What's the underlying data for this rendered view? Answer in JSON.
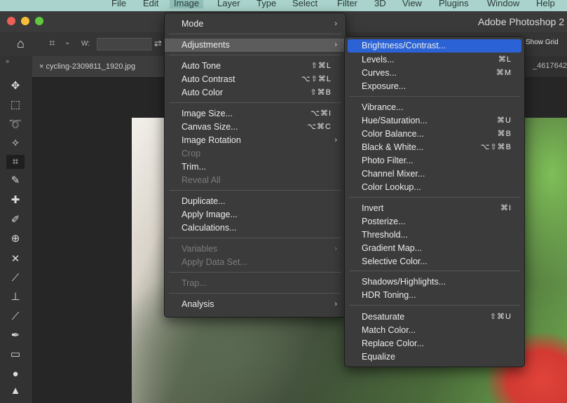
{
  "menubar": {
    "items": [
      "File",
      "Edit",
      "Image",
      "Layer",
      "Type",
      "Select",
      "Filter",
      "3D",
      "View",
      "Plugins",
      "Window",
      "Help"
    ]
  },
  "window": {
    "title": "Adobe Photoshop 2",
    "traffic_colors": [
      "#ee5f57",
      "#f6be3b",
      "#5fc83f"
    ]
  },
  "options": {
    "w_label": "W:",
    "show_grid_label": "Show Grid"
  },
  "document": {
    "tab_label": "cycling-2309811_1920.jpg",
    "right_label": "_4617642"
  },
  "image_menu": {
    "items": [
      {
        "label": "Mode",
        "shortcut": "",
        "submenu": true,
        "disabled": false
      },
      {
        "label": "Adjustments",
        "shortcut": "",
        "submenu": true,
        "disabled": false,
        "highlighted": true
      },
      {
        "label": "Auto Tone",
        "shortcut": "⇧⌘L",
        "submenu": false,
        "disabled": false
      },
      {
        "label": "Auto Contrast",
        "shortcut": "⌥⇧⌘L",
        "submenu": false,
        "disabled": false
      },
      {
        "label": "Auto Color",
        "shortcut": "⇧⌘B",
        "submenu": false,
        "disabled": false
      },
      {
        "label": "Image Size...",
        "shortcut": "⌥⌘I",
        "submenu": false,
        "disabled": false
      },
      {
        "label": "Canvas Size...",
        "shortcut": "⌥⌘C",
        "submenu": false,
        "disabled": false
      },
      {
        "label": "Image Rotation",
        "shortcut": "",
        "submenu": true,
        "disabled": false
      },
      {
        "label": "Crop",
        "shortcut": "",
        "submenu": false,
        "disabled": true
      },
      {
        "label": "Trim...",
        "shortcut": "",
        "submenu": false,
        "disabled": false
      },
      {
        "label": "Reveal All",
        "shortcut": "",
        "submenu": false,
        "disabled": true
      },
      {
        "label": "Duplicate...",
        "shortcut": "",
        "submenu": false,
        "disabled": false
      },
      {
        "label": "Apply Image...",
        "shortcut": "",
        "submenu": false,
        "disabled": false
      },
      {
        "label": "Calculations...",
        "shortcut": "",
        "submenu": false,
        "disabled": false
      },
      {
        "label": "Variables",
        "shortcut": "",
        "submenu": true,
        "disabled": true
      },
      {
        "label": "Apply Data Set...",
        "shortcut": "",
        "submenu": false,
        "disabled": true
      },
      {
        "label": "Trap...",
        "shortcut": "",
        "submenu": false,
        "disabled": true
      },
      {
        "label": "Analysis",
        "shortcut": "",
        "submenu": true,
        "disabled": false
      }
    ]
  },
  "adjustments_menu": {
    "items": [
      {
        "label": "Brightness/Contrast...",
        "shortcut": "",
        "selected": true
      },
      {
        "label": "Levels...",
        "shortcut": "⌘L"
      },
      {
        "label": "Curves...",
        "shortcut": "⌘M"
      },
      {
        "label": "Exposure...",
        "shortcut": ""
      },
      {
        "label": "Vibrance...",
        "shortcut": ""
      },
      {
        "label": "Hue/Saturation...",
        "shortcut": "⌘U"
      },
      {
        "label": "Color Balance...",
        "shortcut": "⌘B"
      },
      {
        "label": "Black & White...",
        "shortcut": "⌥⇧⌘B"
      },
      {
        "label": "Photo Filter...",
        "shortcut": ""
      },
      {
        "label": "Channel Mixer...",
        "shortcut": ""
      },
      {
        "label": "Color Lookup...",
        "shortcut": ""
      },
      {
        "label": "Invert",
        "shortcut": "⌘I"
      },
      {
        "label": "Posterize...",
        "shortcut": ""
      },
      {
        "label": "Threshold...",
        "shortcut": ""
      },
      {
        "label": "Gradient Map...",
        "shortcut": ""
      },
      {
        "label": "Selective Color...",
        "shortcut": ""
      },
      {
        "label": "Shadows/Highlights...",
        "shortcut": ""
      },
      {
        "label": "HDR Toning...",
        "shortcut": ""
      },
      {
        "label": "Desaturate",
        "shortcut": "⇧⌘U"
      },
      {
        "label": "Match Color...",
        "shortcut": ""
      },
      {
        "label": "Replace Color...",
        "shortcut": ""
      },
      {
        "label": "Equalize",
        "shortcut": ""
      }
    ]
  },
  "tools": [
    {
      "icon": "move-icon",
      "glyph": "✥"
    },
    {
      "icon": "marquee-icon",
      "glyph": "⬚"
    },
    {
      "icon": "lasso-icon",
      "glyph": "➰"
    },
    {
      "icon": "magic-wand-icon",
      "glyph": "✧"
    },
    {
      "icon": "crop-icon",
      "glyph": "⌗"
    },
    {
      "icon": "eyedropper-icon",
      "glyph": "✎"
    },
    {
      "icon": "healing-brush-icon",
      "glyph": "✚"
    },
    {
      "icon": "brush-icon",
      "glyph": "✐"
    },
    {
      "icon": "clone-stamp-icon",
      "glyph": "⊕"
    },
    {
      "icon": "history-brush-icon",
      "glyph": "✕"
    },
    {
      "icon": "eraser-icon",
      "glyph": "⟋"
    },
    {
      "icon": "stamp-icon",
      "glyph": "⊥"
    },
    {
      "icon": "dodge-icon",
      "glyph": "⟋"
    },
    {
      "icon": "pen-icon",
      "glyph": "✒"
    },
    {
      "icon": "gradient-icon",
      "glyph": "▭"
    },
    {
      "icon": "drop-icon",
      "glyph": "●"
    },
    {
      "icon": "shape-icon",
      "glyph": "▲"
    }
  ]
}
